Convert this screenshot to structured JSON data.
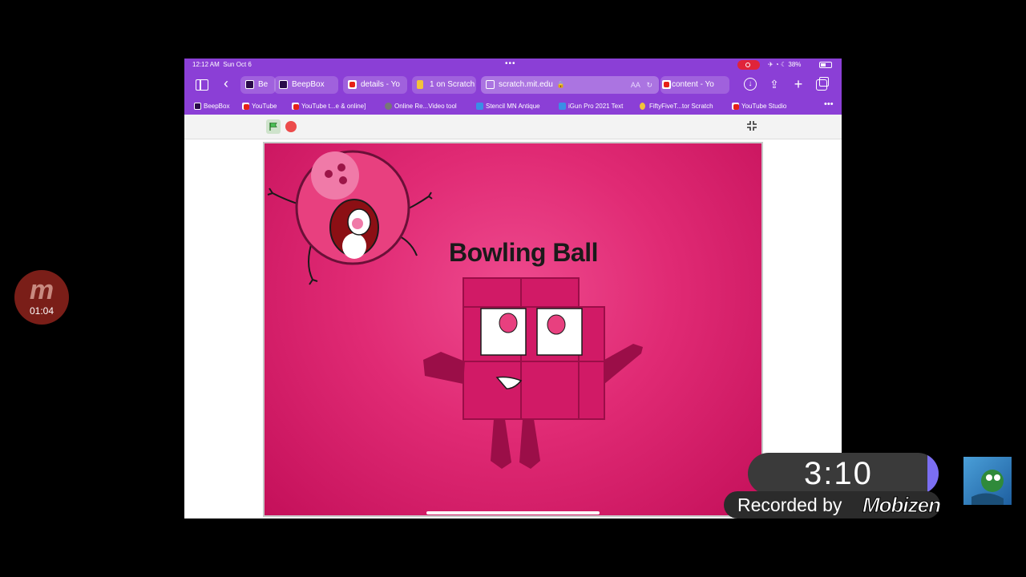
{
  "status_bar": {
    "time": "12:12 AM",
    "date": "Sun Oct 6",
    "dots": "•••",
    "battery": "38%"
  },
  "tabs": [
    {
      "label": "Be",
      "favicon": "beepbox"
    },
    {
      "label": "BeepBox",
      "favicon": "beepbox"
    },
    {
      "label": "details - Yo",
      "favicon": "youtube"
    },
    {
      "label": "1 on Scratch",
      "favicon": "scratch"
    },
    {
      "label": "scratch.mit.edu",
      "favicon": "scratch-page",
      "extra": "AA",
      "active": true
    },
    {
      "label": "content - Yo",
      "favicon": "youtube"
    }
  ],
  "bookmarks": [
    {
      "label": "BeepBox",
      "favicon": "beepbox"
    },
    {
      "label": "YouTube",
      "favicon": "youtube"
    },
    {
      "label": "YouTube t...e & online]",
      "favicon": "youtube"
    },
    {
      "label": "Online Re...Video tool",
      "favicon": "recorder"
    },
    {
      "label": "Stencil MN Antique",
      "favicon": "stencil"
    },
    {
      "label": "iGun Pro 2021 Text",
      "favicon": "stencil"
    },
    {
      "label": "FiftyFiveT...tor Scratch",
      "favicon": "scratch"
    },
    {
      "label": "YouTube Studio",
      "favicon": "youtube"
    }
  ],
  "stage": {
    "title": "Bowling Ball"
  },
  "mobizen_badge": {
    "letter": "m",
    "time": "01:04"
  },
  "timer": "3:10",
  "recorded": {
    "text": "Recorded by",
    "brand": "Mobizen"
  },
  "colors": {
    "browser_purple": "#8b3fd6",
    "stage_pink": "#e02a74",
    "youtube_red": "#e62117",
    "stop_red": "#ec4b4b"
  },
  "icons": [
    "sidebar-icon",
    "back-icon",
    "download-icon",
    "share-icon",
    "plus-icon",
    "tabs-icon",
    "green-flag-icon",
    "stop-icon",
    "fullscreen-icon",
    "lock-icon",
    "reload-icon",
    "more-icon"
  ]
}
